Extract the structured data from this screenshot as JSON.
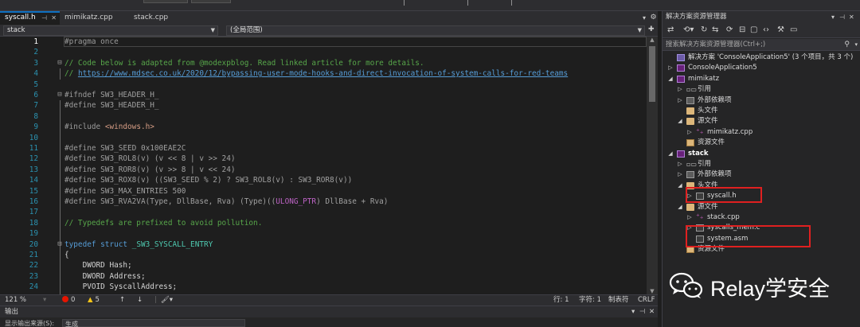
{
  "editor_tabs": [
    {
      "label": "syscall.h",
      "active": true
    },
    {
      "label": "mimikatz.cpp",
      "active": false
    },
    {
      "label": "stack.cpp",
      "active": false
    }
  ],
  "navbar": {
    "scope": "stack",
    "member": "(全局范围)"
  },
  "code": {
    "lines": [
      {
        "n": "1",
        "tokens": [
          [
            "c-pp",
            "#pragma once"
          ]
        ]
      },
      {
        "n": "2",
        "tokens": []
      },
      {
        "n": "3",
        "tokens": [
          [
            "c-cm",
            "// Code below is adapted from @modexpblog. Read linked article for more details."
          ]
        ]
      },
      {
        "n": "4",
        "tokens": [
          [
            "c-cm",
            "// "
          ],
          [
            "c-link",
            "https://www.mdsec.co.uk/2020/12/bypassing-user-mode-hooks-and-direct-invocation-of-system-calls-for-red-teams"
          ]
        ]
      },
      {
        "n": "5",
        "tokens": []
      },
      {
        "n": "6",
        "tokens": [
          [
            "c-pp",
            "#ifndef "
          ],
          [
            "c-gr",
            "SW3_HEADER_H_"
          ]
        ]
      },
      {
        "n": "7",
        "tokens": [
          [
            "c-pp",
            "#define "
          ],
          [
            "c-gr",
            "SW3_HEADER_H_"
          ]
        ]
      },
      {
        "n": "8",
        "tokens": []
      },
      {
        "n": "9",
        "tokens": [
          [
            "c-pp",
            "#include "
          ],
          [
            "c-str",
            "<windows.h>"
          ]
        ]
      },
      {
        "n": "10",
        "tokens": []
      },
      {
        "n": "11",
        "tokens": [
          [
            "c-pp",
            "#define "
          ],
          [
            "c-gr",
            "SW3_SEED 0x100EAE2C"
          ]
        ]
      },
      {
        "n": "12",
        "tokens": [
          [
            "c-pp",
            "#define "
          ],
          [
            "c-gr",
            "SW3_ROL8(v) (v << 8 | v >> 24)"
          ]
        ]
      },
      {
        "n": "13",
        "tokens": [
          [
            "c-pp",
            "#define "
          ],
          [
            "c-gr",
            "SW3_ROR8(v) (v >> 8 | v << 24)"
          ]
        ]
      },
      {
        "n": "14",
        "tokens": [
          [
            "c-pp",
            "#define "
          ],
          [
            "c-gr",
            "SW3_ROX8(v) ((SW3_SEED % 2) ? SW3_ROL8(v) : SW3_ROR8(v))"
          ]
        ]
      },
      {
        "n": "15",
        "tokens": [
          [
            "c-pp",
            "#define "
          ],
          [
            "c-gr",
            "SW3_MAX_ENTRIES 500"
          ]
        ]
      },
      {
        "n": "16",
        "tokens": [
          [
            "c-pp",
            "#define "
          ],
          [
            "c-gr",
            "SW3_RVA2VA(Type, DllBase, Rva) (Type)(("
          ],
          [
            "c-mac",
            "ULONG_PTR"
          ],
          [
            "c-gr",
            ") DllBase + Rva)"
          ]
        ]
      },
      {
        "n": "17",
        "tokens": []
      },
      {
        "n": "18",
        "tokens": [
          [
            "c-cm",
            "// Typedefs are prefixed to avoid pollution."
          ]
        ]
      },
      {
        "n": "19",
        "tokens": []
      },
      {
        "n": "20",
        "tokens": [
          [
            "c-kw",
            "typedef struct "
          ],
          [
            "c-ty",
            "_SW3_SYSCALL_ENTRY"
          ]
        ]
      },
      {
        "n": "21",
        "tokens": [
          [
            "c-pl",
            "{"
          ]
        ]
      },
      {
        "n": "22",
        "tokens": [
          [
            "c-pl",
            "    DWORD Hash;"
          ]
        ]
      },
      {
        "n": "23",
        "tokens": [
          [
            "c-pl",
            "    DWORD Address;"
          ]
        ]
      },
      {
        "n": "24",
        "tokens": [
          [
            "c-pl",
            "    PVOID SyscallAddress;"
          ]
        ]
      }
    ]
  },
  "status": {
    "zoom": "121 %",
    "errors": "0",
    "warnings": "5",
    "line": "行: 1",
    "char": "字符: 1",
    "tabs": "制表符",
    "eol": "CRLF"
  },
  "output": {
    "title": "输出",
    "toolbar_label": "显示输出来源(S):",
    "source": "生成"
  },
  "solution_explorer": {
    "title": "解决方案资源管理器",
    "search_placeholder": "搜索解决方案资源管理器(Ctrl+;)",
    "tree": [
      {
        "label": "解决方案 'ConsoleApplication5' (3 个项目，共 3 个)",
        "level": 0,
        "icon": "ico-sln",
        "exp": ""
      },
      {
        "label": "ConsoleApplication5",
        "level": 0,
        "icon": "ico-proj",
        "exp": "▷"
      },
      {
        "label": "mimikatz",
        "level": 0,
        "icon": "ico-proj",
        "exp": "◢"
      },
      {
        "label": "引用",
        "level": 1,
        "icon": "ico-ref",
        "exp": "▷"
      },
      {
        "label": "外部依赖项",
        "level": 1,
        "icon": "ico-ext",
        "exp": "▷"
      },
      {
        "label": "头文件",
        "level": 1,
        "icon": "ico-folder",
        "exp": ""
      },
      {
        "label": "源文件",
        "level": 1,
        "icon": "ico-folder",
        "exp": "◢"
      },
      {
        "label": "mimikatz.cpp",
        "level": 2,
        "icon": "ico-cpp",
        "exp": "▷"
      },
      {
        "label": "资源文件",
        "level": 1,
        "icon": "ico-res",
        "exp": ""
      },
      {
        "label": "stack",
        "level": 0,
        "icon": "ico-proj",
        "exp": "◢",
        "bold": true
      },
      {
        "label": "引用",
        "level": 1,
        "icon": "ico-ref",
        "exp": "▷"
      },
      {
        "label": "外部依赖项",
        "level": 1,
        "icon": "ico-ext",
        "exp": "▷"
      },
      {
        "label": "头文件",
        "level": 1,
        "icon": "ico-folder",
        "exp": "◢"
      },
      {
        "label": "syscall.h",
        "level": 2,
        "icon": "ico-h",
        "exp": "▷"
      },
      {
        "label": "源文件",
        "level": 1,
        "icon": "ico-folder",
        "exp": "◢"
      },
      {
        "label": "stack.cpp",
        "level": 2,
        "icon": "ico-cpp",
        "exp": "▷"
      },
      {
        "label": "syscalls_mem.c",
        "level": 2,
        "icon": "ico-c",
        "exp": "▷"
      },
      {
        "label": "system.asm",
        "level": 2,
        "icon": "ico-c",
        "exp": ""
      },
      {
        "label": "资源文件",
        "level": 1,
        "icon": "ico-res",
        "exp": ""
      }
    ]
  },
  "watermark": {
    "text": "Relay学安全",
    "logo_icon": "wechat-logo"
  },
  "colors": {
    "accent": "#0e70c0",
    "highlight_box": "#e02020",
    "comment": "#57a64a",
    "keyword": "#569cd6"
  }
}
